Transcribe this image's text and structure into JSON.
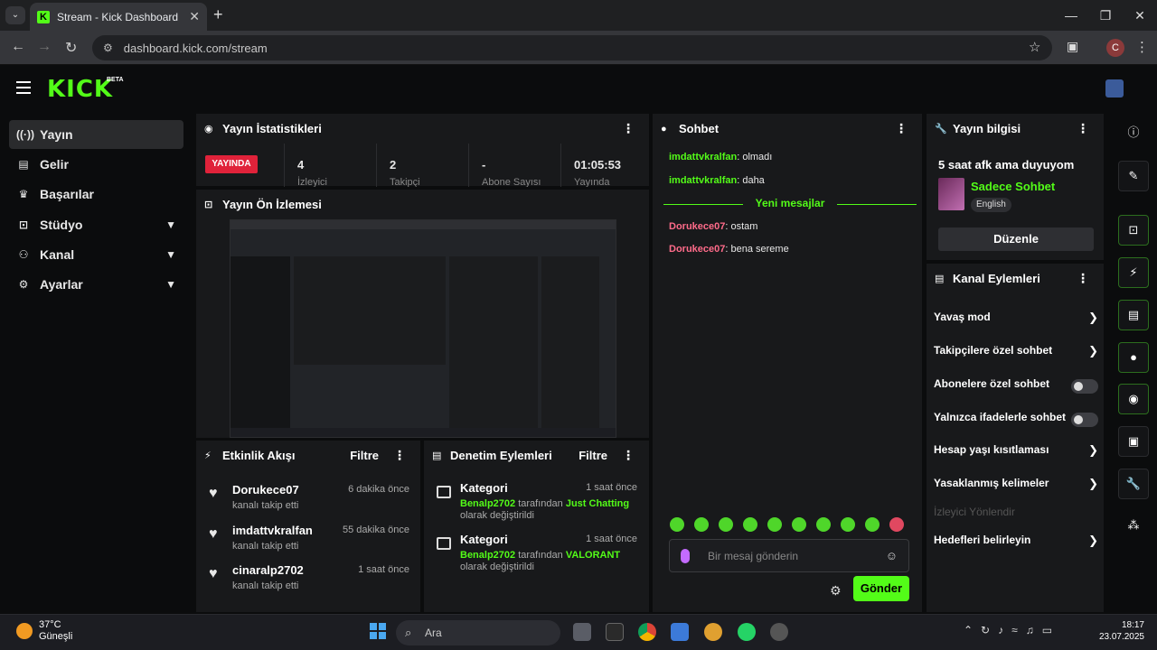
{
  "browser": {
    "tab_title": "Stream - Kick Dashboard",
    "tab_close": "✕",
    "new_tab": "+",
    "url": "dashboard.kick.com/stream",
    "profile_initial": "C"
  },
  "header": {
    "logo": "KICK",
    "beta": "BETA"
  },
  "sidebar": {
    "items": [
      {
        "label": "Yayın",
        "icon": "broadcast-icon",
        "active": true
      },
      {
        "label": "Gelir",
        "icon": "chart-icon"
      },
      {
        "label": "Başarılar",
        "icon": "trophy-icon"
      },
      {
        "label": "Stüdyo",
        "icon": "studio-icon",
        "expandable": true
      },
      {
        "label": "Kanal",
        "icon": "channel-icon",
        "expandable": true
      },
      {
        "label": "Ayarlar",
        "icon": "gear-icon",
        "expandable": true
      }
    ]
  },
  "stats": {
    "title": "Yayın İstatistikleri",
    "badge": "YAYINDA",
    "values": [
      {
        "value": "4",
        "label": "İzleyici"
      },
      {
        "value": "2",
        "label": "Takipçi"
      },
      {
        "value": "-",
        "label": "Abone Sayısı"
      },
      {
        "value": "01:05:53",
        "label": "Yayında"
      }
    ]
  },
  "preview": {
    "title": "Yayın Ön İzlemesi"
  },
  "events": {
    "title": "Etkinlik Akışı",
    "filter": "Filtre",
    "items": [
      {
        "name": "Dorukece07",
        "action": "kanalı takip etti",
        "time": "6 dakika önce"
      },
      {
        "name": "imdattvkralfan",
        "action": "kanalı takip etti",
        "time": "55 dakika önce"
      },
      {
        "name": "cinaralp2702",
        "action": "kanalı takip etti",
        "time": "1 saat önce"
      }
    ]
  },
  "moderation": {
    "title": "Denetim Eylemleri",
    "filter": "Filtre",
    "items": [
      {
        "title": "Kategori",
        "time": "1 saat önce",
        "user": "Benalp2702",
        "mid": "tarafından",
        "target": "Just Chatting",
        "tail": "olarak değiştirildi"
      },
      {
        "title": "Kategori",
        "time": "1 saat önce",
        "user": "Benalp2702",
        "mid": "tarafından",
        "target": "VALORANT",
        "tail": "olarak değiştirildi"
      }
    ]
  },
  "chat": {
    "title": "Sohbet",
    "messages_before": [
      {
        "user": "imdattvkralfan",
        "text": "olmadı",
        "color": "#53fc18"
      },
      {
        "user": "imdattvkralfan",
        "text": "daha",
        "color": "#53fc18"
      }
    ],
    "divider": "Yeni mesajlar",
    "messages_after": [
      {
        "user": "Dorukece07",
        "text": "ostam",
        "color": "#ff6b8a"
      },
      {
        "user": "Dorukece07",
        "text": "bena sereme",
        "color": "#ff6b8a"
      }
    ],
    "placeholder": "Bir mesaj gönderin",
    "send": "Gönder"
  },
  "stream_info": {
    "title": "Yayın bilgisi",
    "stream_title": "5 saat afk ama duyuyom",
    "category": "Sadece Sohbet",
    "language": "English",
    "edit": "Düzenle"
  },
  "channel_actions": {
    "title": "Kanal Eylemleri",
    "items": [
      {
        "label": "Yavaş mod",
        "kind": "arrow"
      },
      {
        "label": "Takipçilere özel sohbet",
        "kind": "arrow"
      },
      {
        "label": "Abonelere özel sohbet",
        "kind": "toggle"
      },
      {
        "label": "Yalnızca ifadelerle sohbet",
        "kind": "toggle"
      },
      {
        "label": "Hesap yaşı kısıtlaması",
        "kind": "arrow"
      },
      {
        "label": "Yasaklanmış kelimeler",
        "kind": "arrow"
      },
      {
        "label": "İzleyici Yönlendir",
        "kind": "disabled"
      },
      {
        "label": "Hedefleri belirleyin",
        "kind": "arrow"
      }
    ]
  },
  "taskbar": {
    "weather_temp": "37°C",
    "weather_desc": "Güneşli",
    "search": "Ara",
    "time": "18:17",
    "date": "23.07.2025"
  },
  "colors": {
    "accent": "#53fc18",
    "live": "#e0223a",
    "panel": "#18191b"
  }
}
